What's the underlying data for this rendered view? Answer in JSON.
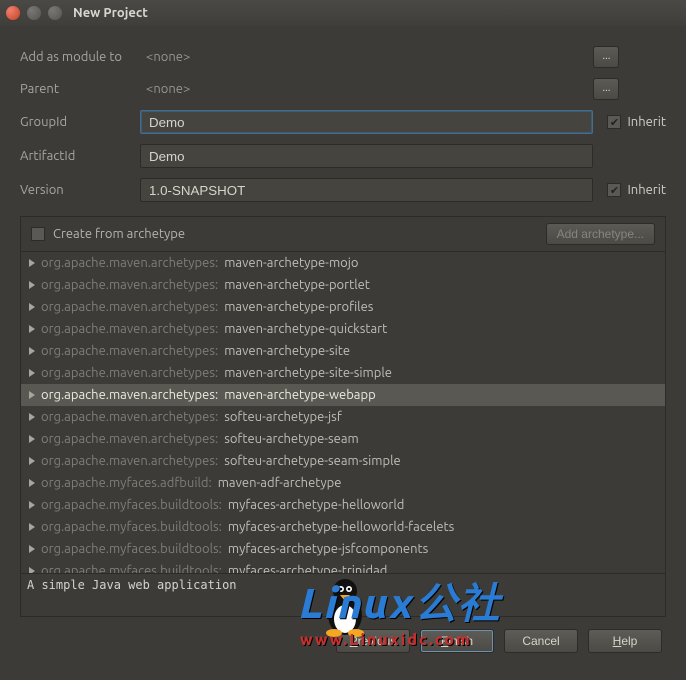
{
  "window": {
    "title": "New Project"
  },
  "form": {
    "add_as_module_label": "Add as module to",
    "add_as_module_value": "<none>",
    "parent_label": "Parent",
    "parent_value": "<none>",
    "group_id_label": "GroupId",
    "group_id_value": "Demo",
    "artifact_id_label": "ArtifactId",
    "artifact_id_value": "Demo",
    "version_label": "Version",
    "version_value": "1.0-SNAPSHOT",
    "inherit_label": "Inherit",
    "ellipsis": "...",
    "create_from_archetype": "Create from archetype",
    "add_archetype_btn": "Add archetype..."
  },
  "archetypes": [
    {
      "prefix": "org.apache.maven.archetypes:",
      "name": "maven-archetype-mojo"
    },
    {
      "prefix": "org.apache.maven.archetypes:",
      "name": "maven-archetype-portlet"
    },
    {
      "prefix": "org.apache.maven.archetypes:",
      "name": "maven-archetype-profiles"
    },
    {
      "prefix": "org.apache.maven.archetypes:",
      "name": "maven-archetype-quickstart"
    },
    {
      "prefix": "org.apache.maven.archetypes:",
      "name": "maven-archetype-site"
    },
    {
      "prefix": "org.apache.maven.archetypes:",
      "name": "maven-archetype-site-simple"
    },
    {
      "prefix": "org.apache.maven.archetypes:",
      "name": "maven-archetype-webapp",
      "selected": true
    },
    {
      "prefix": "org.apache.maven.archetypes:",
      "name": "softeu-archetype-jsf"
    },
    {
      "prefix": "org.apache.maven.archetypes:",
      "name": "softeu-archetype-seam"
    },
    {
      "prefix": "org.apache.maven.archetypes:",
      "name": "softeu-archetype-seam-simple"
    },
    {
      "prefix": "org.apache.myfaces.adfbuild:",
      "name": "maven-adf-archetype"
    },
    {
      "prefix": "org.apache.myfaces.buildtools:",
      "name": "myfaces-archetype-helloworld"
    },
    {
      "prefix": "org.apache.myfaces.buildtools:",
      "name": "myfaces-archetype-helloworld-facelets"
    },
    {
      "prefix": "org.apache.myfaces.buildtools:",
      "name": "myfaces-archetype-jsfcomponents"
    },
    {
      "prefix": "org.apache.myfaces.buildtools:",
      "name": "myfaces-archetype-trinidad"
    }
  ],
  "description": "A simple Java web application",
  "buttons": {
    "previous": "Previous",
    "finish": "Finish",
    "cancel": "Cancel",
    "help": "Help"
  },
  "watermark": {
    "main": "Linux公社",
    "sub": "www.Linuxidc.com"
  }
}
